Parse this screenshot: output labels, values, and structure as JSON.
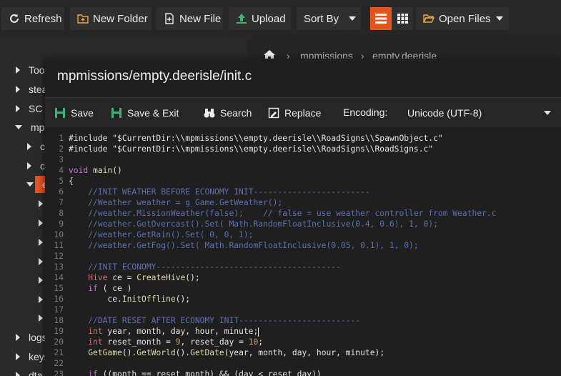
{
  "toolbar": {
    "refresh": "Refresh",
    "new_folder": "New Folder",
    "new_file": "New File",
    "upload": "Upload",
    "sort_by": "Sort By",
    "open_files": "Open Files"
  },
  "colors": {
    "accent": "#e5541f",
    "upload_icon": "#3cb371",
    "folder_icon": "#e8a93a"
  },
  "breadcrumb": [
    "mpmissions",
    "empty.deerisle"
  ],
  "tree": {
    "items": [
      {
        "label": "Too",
        "expanded": false
      },
      {
        "label": "stea",
        "expanded": false
      },
      {
        "label": "SC",
        "expanded": false
      },
      {
        "label": "mp",
        "expanded": true
      },
      {
        "label": "c",
        "expanded": false
      },
      {
        "label": "c",
        "expanded": false
      },
      {
        "label": "e",
        "expanded": true
      },
      {
        "label": "logs",
        "expanded": false
      },
      {
        "label": "keys",
        "expanded": false
      },
      {
        "label": "dta",
        "expanded": false
      }
    ]
  },
  "editor": {
    "title": "mpmissions/empty.deerisle/init.c",
    "save": "Save",
    "save_exit": "Save & Exit",
    "search": "Search",
    "replace": "Replace",
    "encoding_label": "Encoding:",
    "encoding_value": "Unicode (UTF-8)",
    "lines": [
      {
        "n": "1",
        "t": "#include \"$CurrentDir:\\\\mpmissions\\\\empty.deerisle\\\\RoadSigns\\\\SpawnObject.c\""
      },
      {
        "n": "2",
        "t": "#include \"$CurrentDir:\\\\mpmissions\\\\empty.deerisle\\\\RoadSigns\\\\RoadSigns.c\""
      },
      {
        "n": "3",
        "t": ""
      },
      {
        "n": "4",
        "t": "void main()"
      },
      {
        "n": "5",
        "t": "{"
      },
      {
        "n": "6",
        "t": "    //INIT WEATHER BEFORE ECONOMY INIT------------------------"
      },
      {
        "n": "7",
        "t": "    //Weather weather = g_Game.GetWeather();"
      },
      {
        "n": "8",
        "t": "    //weather.MissionWeather(false);    // false = use weather controller from Weather.c"
      },
      {
        "n": "9",
        "t": "    //weather.GetOvercast().Set( Math.RandomFloatInclusive(0.4, 0.6), 1, 0);"
      },
      {
        "n": "10",
        "t": "    //weather.GetRain().Set( 0, 0, 1);"
      },
      {
        "n": "11",
        "t": "    //weather.GetFog().Set( Math.RandomFloatInclusive(0.05, 0.1), 1, 0);"
      },
      {
        "n": "12",
        "t": ""
      },
      {
        "n": "13",
        "t": "    //INIT ECONOMY--------------------------------------"
      },
      {
        "n": "14",
        "t": "    Hive ce = CreateHive();"
      },
      {
        "n": "15",
        "t": "    if ( ce )"
      },
      {
        "n": "16",
        "t": "        ce.InitOffline();"
      },
      {
        "n": "17",
        "t": ""
      },
      {
        "n": "18",
        "t": "    //DATE RESET AFTER ECONOMY INIT-------------------------"
      },
      {
        "n": "19",
        "t": "    int year, month, day, hour, minute;"
      },
      {
        "n": "20",
        "t": "    int reset_month = 9, reset_day = 10;"
      },
      {
        "n": "21",
        "t": "    GetGame().GetWorld().GetDate(year, month, day, hour, minute);"
      },
      {
        "n": "22",
        "t": ""
      },
      {
        "n": "23",
        "t": "    if ((month == reset_month) && (day < reset_day))"
      }
    ]
  }
}
